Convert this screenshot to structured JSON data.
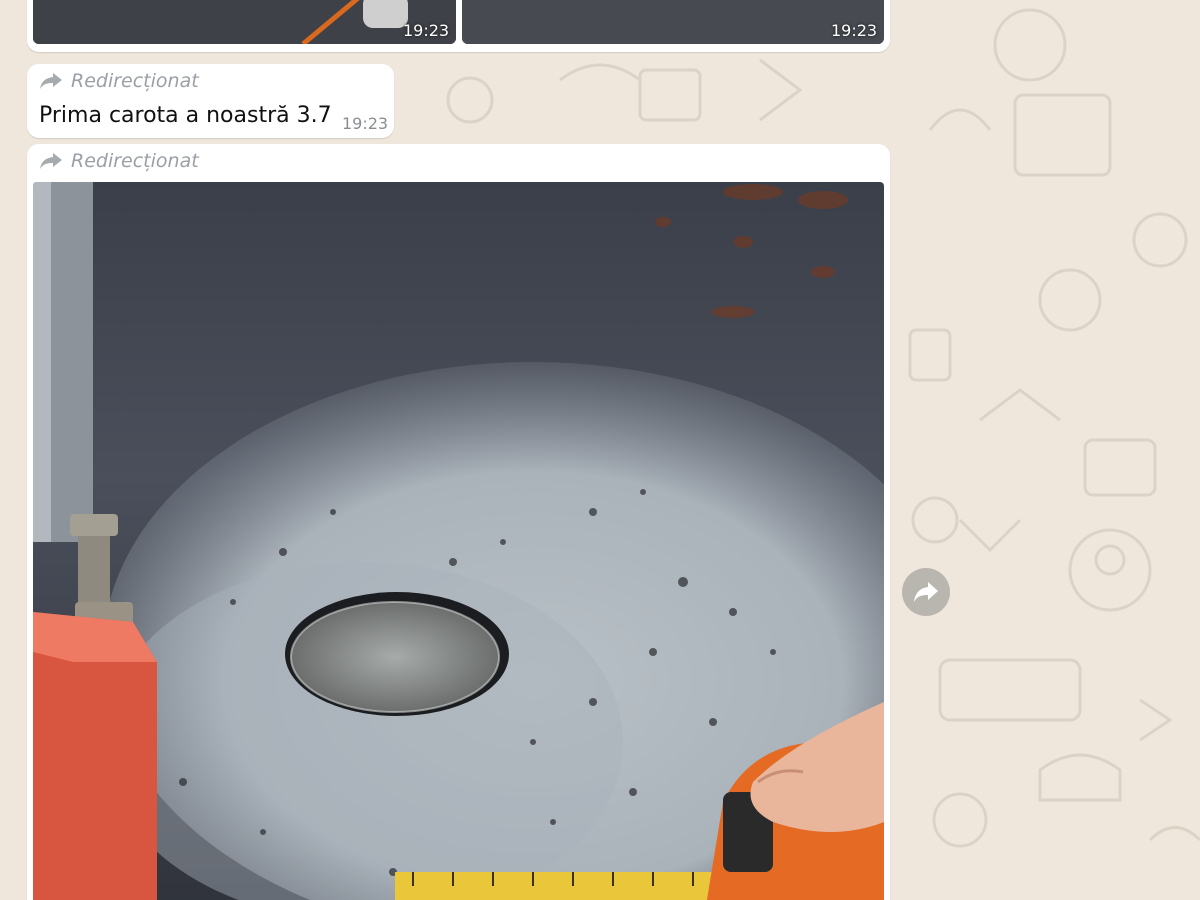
{
  "chat": {
    "top_album": {
      "left_time": "19:23",
      "right_time": "19:23"
    },
    "text_message": {
      "forwarded_label": "Redirecționat",
      "text": "Prima carota a noastră 3.7",
      "time": "19:23"
    },
    "photo_message": {
      "forwarded_label": "Redirecționat"
    }
  },
  "icons": {
    "forward_indicator": "forward-arrow-icon",
    "forward_button": "share-forward-icon"
  },
  "colors": {
    "chat_background": "#efe7dc",
    "bubble": "#ffffff",
    "meta_text": "#9aa0a6"
  }
}
